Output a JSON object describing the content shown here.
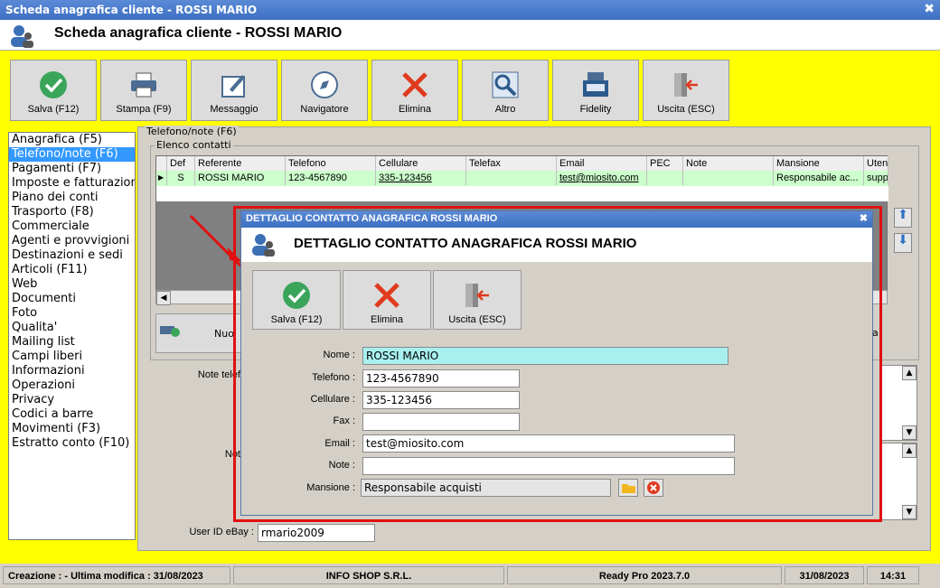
{
  "window": {
    "title": "Scheda anagrafica cliente - ROSSI MARIO",
    "close": "✖"
  },
  "header": {
    "title": "Scheda anagrafica cliente - ROSSI MARIO"
  },
  "toolbar": [
    {
      "label": "Salva (F12)",
      "icon": "check-icon"
    },
    {
      "label": "Stampa (F9)",
      "icon": "printer-icon"
    },
    {
      "label": "Messaggio",
      "icon": "message-icon"
    },
    {
      "label": "Navigatore",
      "icon": "compass-icon"
    },
    {
      "label": "Elimina",
      "icon": "delete-icon"
    },
    {
      "label": "Altro",
      "icon": "magnifier-icon"
    },
    {
      "label": "Fidelity",
      "icon": "cash-register-icon"
    },
    {
      "label": "Uscita (ESC)",
      "icon": "exit-door-icon"
    }
  ],
  "nav": {
    "selected": 1,
    "items": [
      "Anagrafica (F5)",
      "Telefono/note (F6)",
      "Pagamenti (F7)",
      "Imposte e fatturazione",
      "Piano dei conti",
      "Trasporto (F8)",
      "Commerciale",
      "Agenti e provvigioni",
      "Destinazioni e sedi",
      "Articoli (F11)",
      "Web",
      "Documenti",
      "Foto",
      "Qualita'",
      "Mailing list",
      "Campi liberi",
      "Informazioni",
      "Operazioni",
      "Privacy",
      "Codici a barre",
      "Movimenti (F3)",
      "Estratto conto (F10)"
    ]
  },
  "panel": {
    "group_title": "Telefono/note (F6)",
    "contacts_title": "Elenco contatti"
  },
  "grid": {
    "columns": [
      "Def",
      "Referente",
      "Telefono",
      "Cellulare",
      "Telefax",
      "Email",
      "PEC",
      "Note",
      "Mansione",
      "Uten"
    ],
    "row": [
      "S",
      "ROSSI MARIO",
      "123-4567890",
      "335-123456",
      "",
      "test@miosito.com",
      "",
      "",
      "Responsabile ac...",
      "supp"
    ],
    "row_marker": "▶"
  },
  "below": {
    "nuovo_partial": "Nuo",
    "right_partial": "a",
    "note_telefono_label": "Note telef",
    "note_label": "Not",
    "ebay_label": "User ID eBay :",
    "ebay_value": "rmario2009"
  },
  "dialog": {
    "title": "DETTAGLIO CONTATTO ANAGRAFICA ROSSI MARIO",
    "header": "DETTAGLIO CONTATTO ANAGRAFICA ROSSI MARIO",
    "close": "✖",
    "buttons": [
      {
        "label": "Salva (F12)",
        "icon": "check-icon"
      },
      {
        "label": "Elimina",
        "icon": "delete-icon"
      },
      {
        "label": "Uscita (ESC)",
        "icon": "exit-door-icon"
      }
    ],
    "fields": {
      "nome": {
        "label": "Nome :",
        "value": "ROSSI MARIO"
      },
      "telefono": {
        "label": "Telefono :",
        "value": "123-4567890"
      },
      "cellulare": {
        "label": "Cellulare :",
        "value": "335-123456"
      },
      "fax": {
        "label": "Fax :",
        "value": ""
      },
      "email": {
        "label": "Email :",
        "value": "test@miosito.com"
      },
      "note": {
        "label": "Note :",
        "value": ""
      },
      "mansione": {
        "label": "Mansione :",
        "value": "Responsabile acquisti"
      }
    }
  },
  "status": {
    "creazione": "Creazione : - Ultima modifica : 31/08/2023",
    "company": "INFO SHOP S.R.L.",
    "version": "Ready Pro 2023.7.0",
    "date": "31/08/2023",
    "time": "14:31"
  },
  "colors": {
    "highlight": "#ffff00",
    "accent_red": "#e01010",
    "selection": "#3399ff"
  }
}
